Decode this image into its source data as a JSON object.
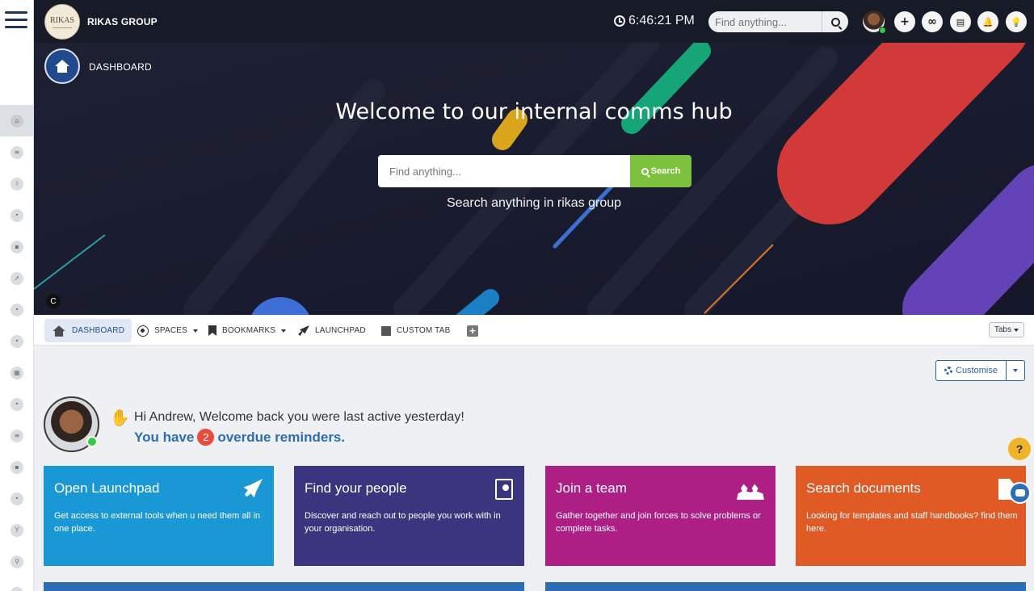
{
  "sidebar": {
    "menu_icon": "hamburger-menu-icon",
    "items": [
      {
        "name": "home",
        "glyph": "⌂",
        "active": true
      },
      {
        "name": "feed",
        "glyph": "≡",
        "active": false
      },
      {
        "name": "info",
        "glyph": "i",
        "active": false
      },
      {
        "name": "groups",
        "glyph": "•",
        "active": false
      },
      {
        "name": "apps",
        "glyph": "▪",
        "active": false
      },
      {
        "name": "launchpad",
        "glyph": "➚",
        "active": false
      },
      {
        "name": "people",
        "glyph": "•",
        "active": false
      },
      {
        "name": "chat",
        "glyph": "•",
        "active": false
      },
      {
        "name": "calendar",
        "glyph": "▦",
        "active": false
      },
      {
        "name": "awards",
        "glyph": "•",
        "active": false
      },
      {
        "name": "lists",
        "glyph": "≡",
        "active": false
      },
      {
        "name": "notes",
        "glyph": "▪",
        "active": false
      },
      {
        "name": "globe",
        "glyph": "•",
        "active": false
      },
      {
        "name": "trophy",
        "glyph": "Y",
        "active": false
      },
      {
        "name": "search",
        "glyph": "⚲",
        "active": false
      },
      {
        "name": "files",
        "glyph": "▯",
        "active": false
      }
    ]
  },
  "header": {
    "logo_text": "RIKAS",
    "brand": "RIKAS GROUP",
    "time": "6:46:21 PM",
    "search_placeholder": "Find anything...",
    "actions": [
      "+",
      "∞",
      "▤",
      "🔔",
      "💡"
    ]
  },
  "banner": {
    "breadcrumb": "DASHBOARD",
    "title": "Welcome to our internal comms hub",
    "search_placeholder": "Find anything...",
    "search_button": "Search",
    "subtitle": "Search anything in rikas group",
    "corner_badge": "C"
  },
  "tabs": {
    "items": [
      {
        "label": "DASHBOARD",
        "icon": "home-icon",
        "active": true,
        "dropdown": false
      },
      {
        "label": "SPACES",
        "icon": "radio-icon",
        "active": false,
        "dropdown": true
      },
      {
        "label": "BOOKMARKS",
        "icon": "bookmark-icon",
        "active": false,
        "dropdown": true
      },
      {
        "label": "LAUNCHPAD",
        "icon": "rocket-icon",
        "active": false,
        "dropdown": false
      },
      {
        "label": "CUSTOM TAB",
        "icon": "square-icon",
        "active": false,
        "dropdown": false
      }
    ],
    "tabs_button": "Tabs"
  },
  "content": {
    "customise_label": "Customise",
    "greeting": "Hi Andrew, Welcome back you were last active yesterday!",
    "reminders_prefix": "You have",
    "reminders_count": "2",
    "reminders_suffix": "overdue reminders.",
    "help_label": "?",
    "cards": [
      {
        "title": "Open Launchpad",
        "description": "Get access to external tools when u need them all in one place.",
        "color": "#1a98d5",
        "icon": "rocket-icon"
      },
      {
        "title": "Find your people",
        "description": "Discover and reach out to people you work with in your organisation.",
        "color": "#3a357e",
        "icon": "contact-book-icon"
      },
      {
        "title": "Join a team",
        "description": "Gather together and join forces to solve problems or complete tasks.",
        "color": "#ad1f84",
        "icon": "people-icon"
      },
      {
        "title": "Search documents",
        "description": "Looking for templates and staff handbooks? find them here.",
        "color": "#e05a26",
        "icon": "document-icon"
      }
    ]
  },
  "colors": {
    "accent": "#2d6db5",
    "search_green": "#7cc23e",
    "online": "#2ecc40",
    "badge_red": "#e74c3c",
    "help_yellow": "#f0b429"
  }
}
